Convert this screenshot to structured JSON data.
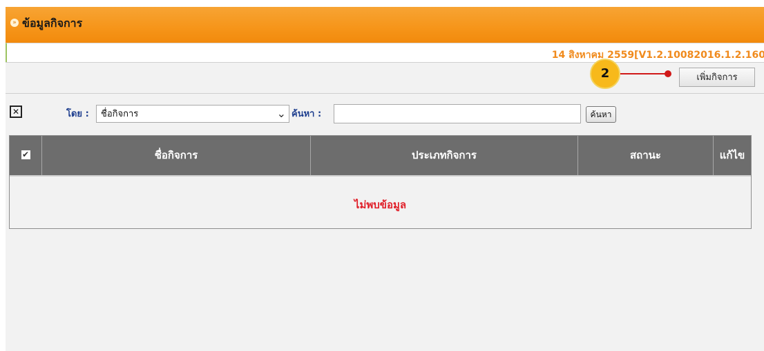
{
  "header": {
    "title": "ข้อมูลกิจการ",
    "bullet_icon": "double-chevron-right-icon"
  },
  "version_line": "14 สิงหาคม 2559[V1.2.10082016.1.2.160",
  "toolbar": {
    "add_business_label": "เพิ่มกิจการ"
  },
  "callout": {
    "number": "2",
    "color": "#d01818",
    "badge_color": "#f7b91b"
  },
  "search": {
    "clear_icon": "checkbox-x-icon",
    "by_label": "โดย :",
    "by_selected": "ชื่อกิจการ",
    "keyword_label": "ค้นหา :",
    "keyword_value": "",
    "search_button": "ค้นหา"
  },
  "table": {
    "columns": [
      "ชื่อกิจการ",
      "ประเภทกิจการ",
      "สถานะ",
      "แก้ไข"
    ],
    "select_all_icon": "checkbox-checked-icon",
    "empty_message": "ไม่พบข้อมูล"
  },
  "colors": {
    "header_orange": "#f6961b",
    "table_header": "#6d6d6d",
    "empty_text": "#e0202a",
    "label_blue": "#1f3f8f"
  }
}
